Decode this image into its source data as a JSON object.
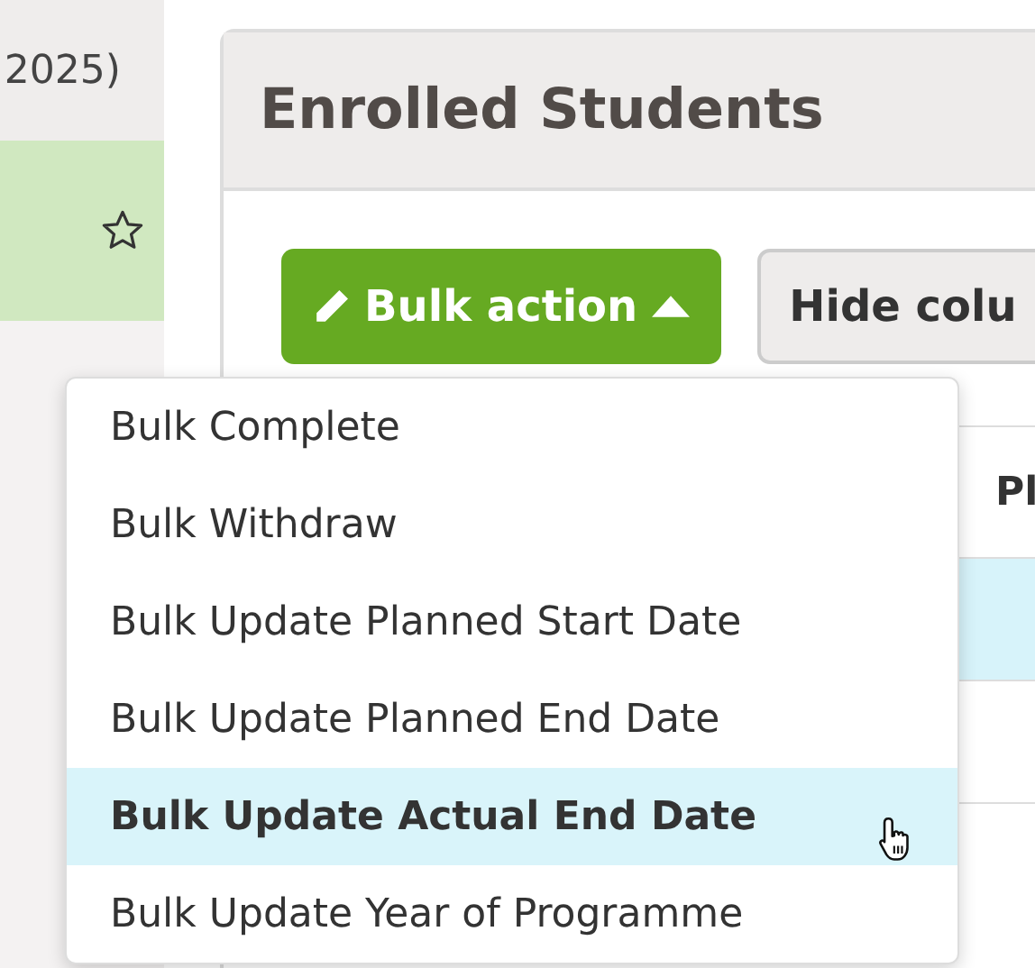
{
  "sidebar": {
    "term_text": "2025)",
    "items": [
      {
        "selected": true,
        "starred": false
      }
    ]
  },
  "panel": {
    "title": "Enrolled Students",
    "buttons": [
      {
        "kind": "primary",
        "label": "Bulk action",
        "expanded": true
      },
      {
        "kind": "default",
        "label": "Hide colu"
      }
    ],
    "table": {
      "columns": [
        "Pl"
      ],
      "rows": [
        {
          "selected": true
        },
        {
          "selected": false
        },
        {
          "selected": false
        }
      ]
    }
  },
  "menu": {
    "items": [
      {
        "label": "Bulk Complete",
        "selected": false
      },
      {
        "label": "Bulk Withdraw",
        "selected": false
      },
      {
        "label": "Bulk Update Planned Start Date",
        "selected": false
      },
      {
        "label": "Bulk Update Planned End Date",
        "selected": false
      },
      {
        "label": "Bulk Update Actual End Date",
        "selected": true
      },
      {
        "label": "Bulk Update Year of Programme",
        "selected": false
      }
    ]
  }
}
